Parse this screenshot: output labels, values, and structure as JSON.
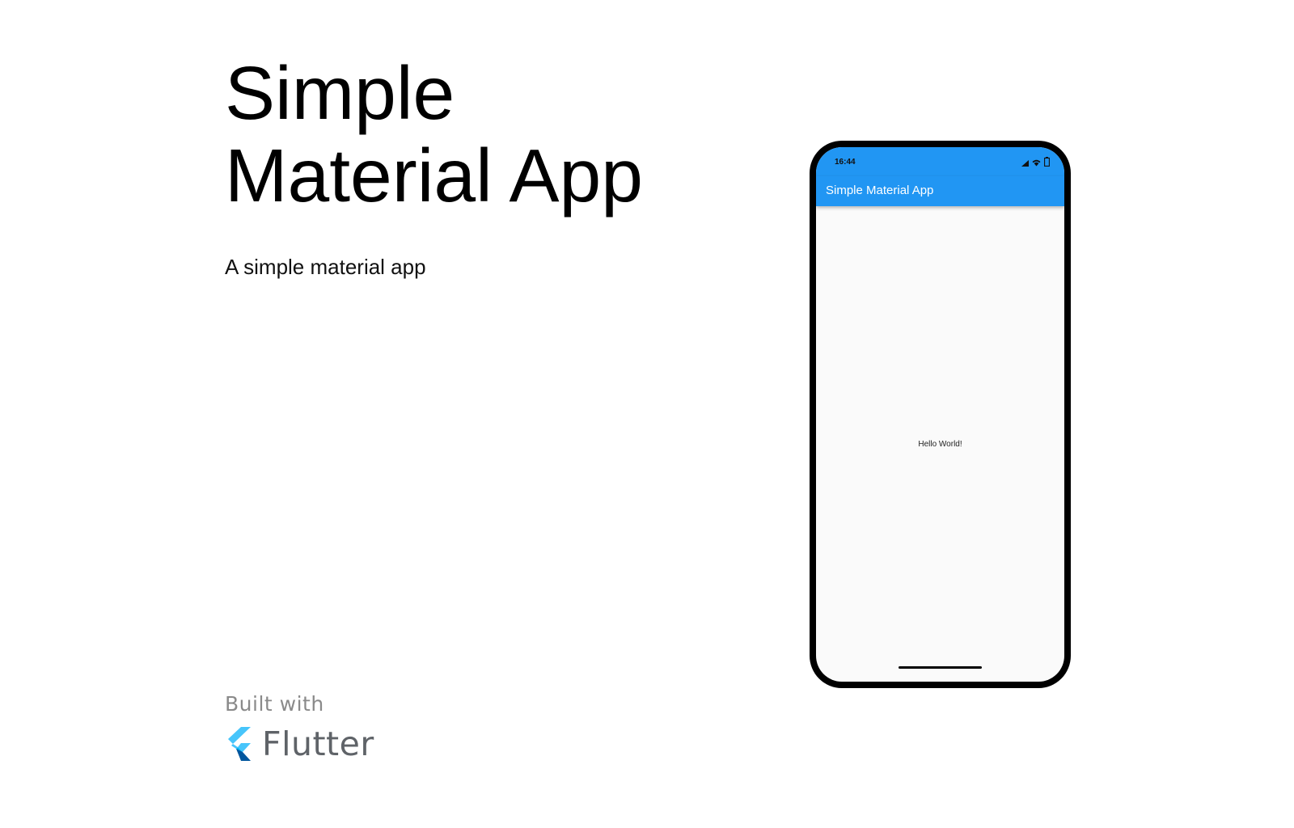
{
  "page": {
    "title": "Simple Material App",
    "description": "A simple material app"
  },
  "badge": {
    "built_with": "Built with",
    "framework": "Flutter",
    "logo_icon": "flutter-logo-icon",
    "logo_colors": [
      "#47c5fb",
      "#00569e",
      "#00b5f8"
    ]
  },
  "device": {
    "status_bar": {
      "time": "16:44",
      "icons": [
        "signal-icon",
        "wifi-icon",
        "battery-icon"
      ]
    },
    "app_bar": {
      "title": "Simple Material App",
      "color": "#2196f3"
    },
    "body": {
      "text": "Hello World!",
      "background": "#fafafa"
    }
  }
}
